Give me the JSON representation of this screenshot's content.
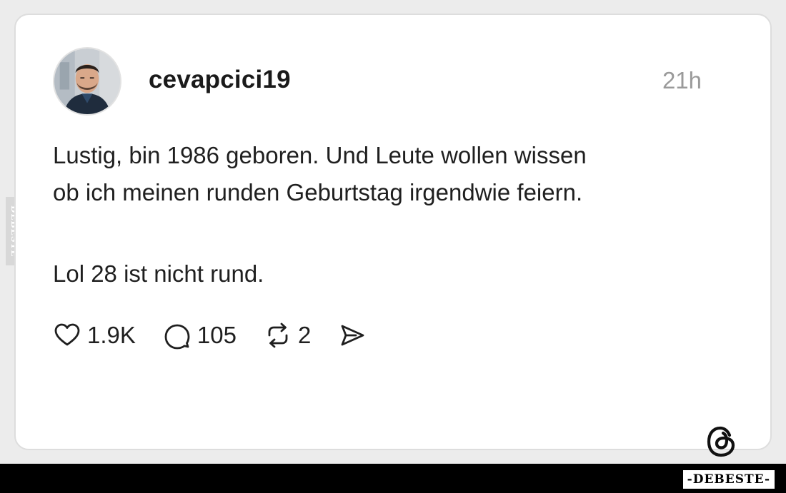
{
  "post": {
    "username": "cevapcici19",
    "timestamp": "21h",
    "text_lines": [
      "Lustig, bin 1986 geboren. Und Leute wollen wissen",
      "ob ich meinen runden Geburtstag irgendwie feiern.",
      "Lol 28 ist nicht rund."
    ]
  },
  "actions": {
    "like": {
      "icon": "heart-icon",
      "count": "1.9K"
    },
    "comment": {
      "icon": "comment-bubble-icon",
      "count": "105"
    },
    "repost": {
      "icon": "repost-icon",
      "count": "2"
    },
    "share": {
      "icon": "send-icon"
    }
  },
  "branding": {
    "app_logo": "threads-logo-icon",
    "side_watermark": "DEBESTE",
    "bottom_watermark": "-DEBESTE-"
  },
  "colors": {
    "background": "#ececec",
    "card": "#ffffff",
    "text": "#1f1f1f",
    "muted": "#9a9a9a"
  }
}
